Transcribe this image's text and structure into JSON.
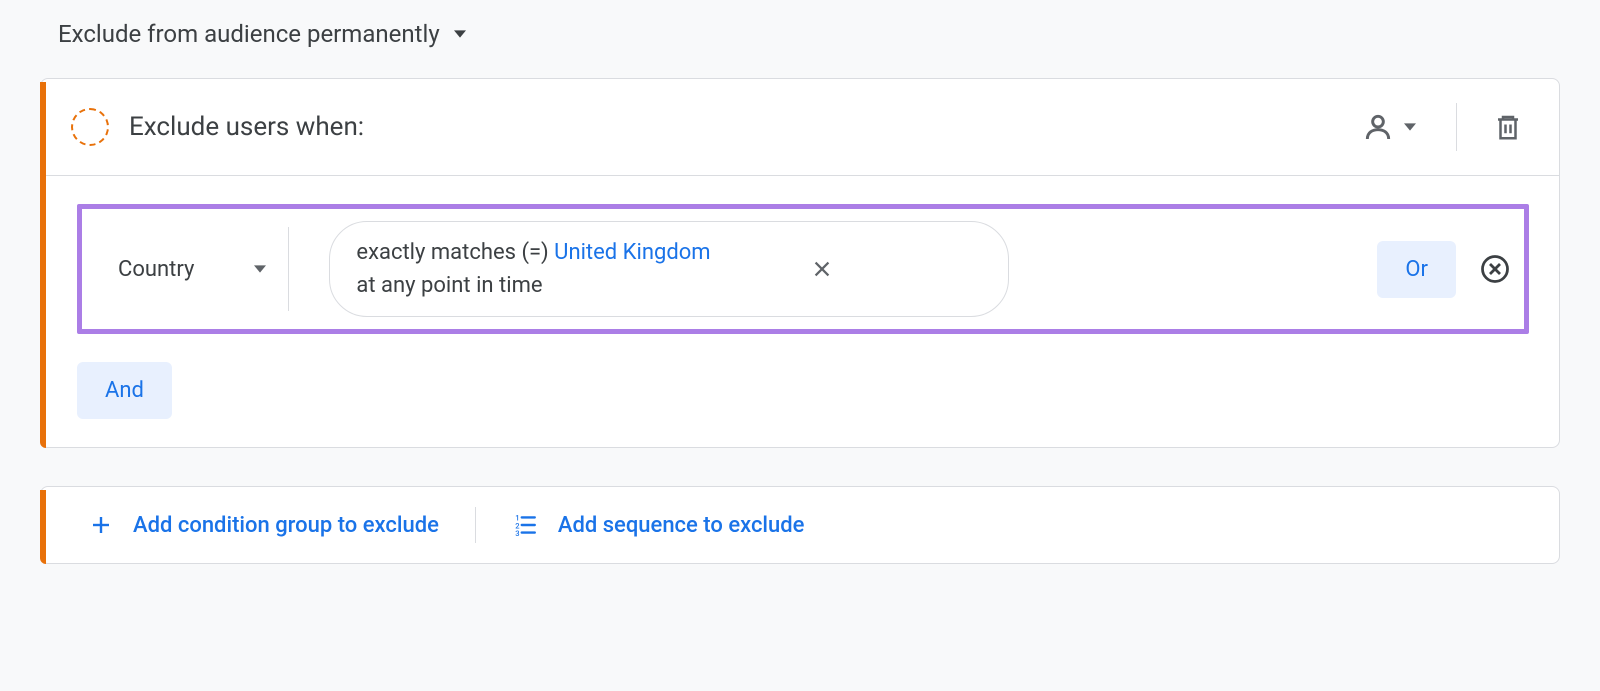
{
  "header": {
    "exclude_mode_label": "Exclude from audience permanently"
  },
  "panel": {
    "title": "Exclude users when:",
    "condition": {
      "dimension": "Country",
      "operator_text": "exactly matches (=) ",
      "value": "United Kingdom",
      "time_scope": "at any point in time"
    },
    "or_label": "Or",
    "and_label": "And"
  },
  "actions": {
    "add_condition_group": "Add condition group to exclude",
    "add_sequence": "Add sequence to exclude"
  }
}
